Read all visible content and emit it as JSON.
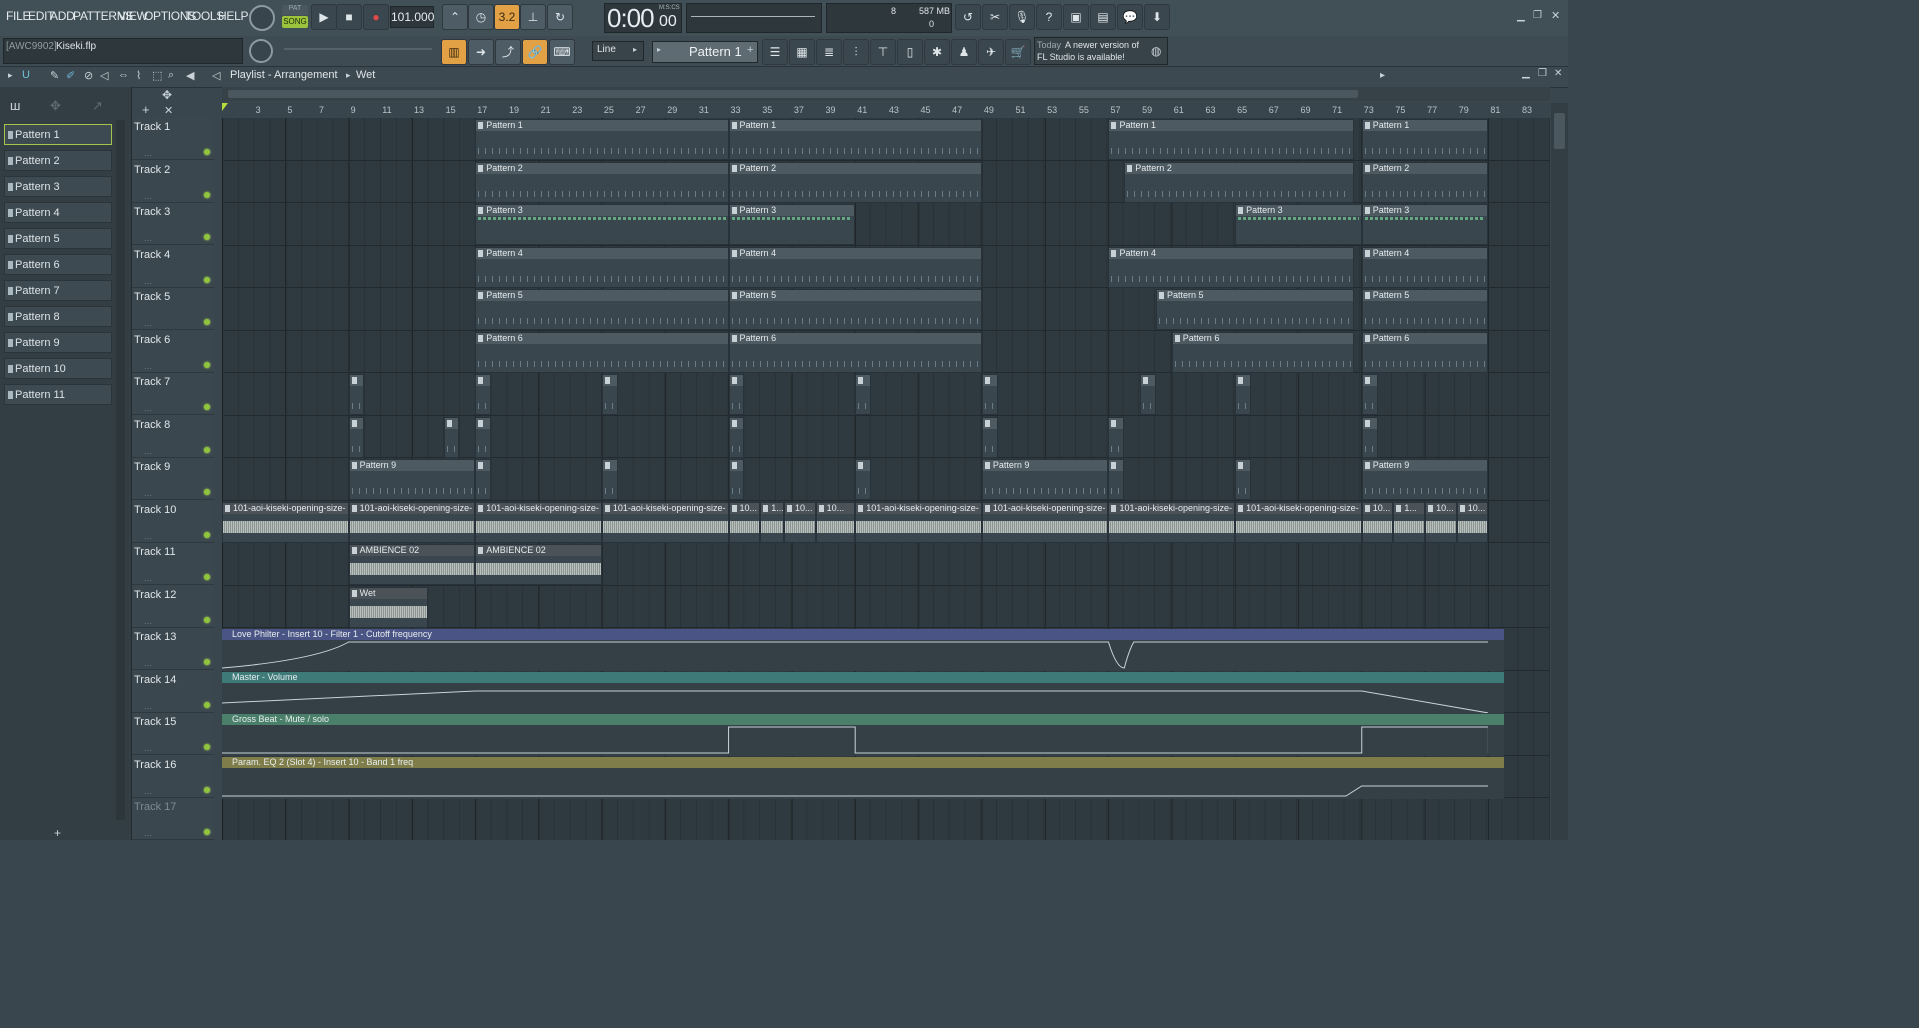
{
  "menu": [
    "FILE",
    "EDIT",
    "ADD",
    "PATTERNS",
    "VIEW",
    "OPTIONS",
    "TOOLS",
    "HELP"
  ],
  "transport": {
    "mode_pat": "PAT",
    "mode_song": "SONG",
    "tempo": "101.000",
    "time": "0:00",
    "time_cs": "00",
    "time_label": "M:S:CS"
  },
  "monitor": {
    "cpu": "8",
    "mem": "587 MB",
    "poly": "0"
  },
  "project": {
    "tag": "[AWC9902]",
    "file": "Kiseki.flp"
  },
  "snap": {
    "label": "Line"
  },
  "pattern_selector": {
    "label": "Pattern 1"
  },
  "news": {
    "date": "Today",
    "line1": "A newer version of",
    "line2": "FL Studio is available!"
  },
  "playlist": {
    "title": "Playlist - Arrangement",
    "crumb": "Wet"
  },
  "patterns": [
    "Pattern 1",
    "Pattern 2",
    "Pattern 3",
    "Pattern 4",
    "Pattern 5",
    "Pattern 6",
    "Pattern 7",
    "Pattern 8",
    "Pattern 9",
    "Pattern 10",
    "Pattern 11"
  ],
  "tracks": [
    "Track 1",
    "Track 2",
    "Track 3",
    "Track 4",
    "Track 5",
    "Track 6",
    "Track 7",
    "Track 8",
    "Track 9",
    "Track 10",
    "Track 11",
    "Track 12",
    "Track 13",
    "Track 14",
    "Track 15",
    "Track 16",
    "Track 17"
  ],
  "ruler": [
    "3",
    "5",
    "7",
    "9",
    "11",
    "13",
    "15",
    "17",
    "19",
    "21",
    "23",
    "25",
    "27",
    "29",
    "31",
    "33",
    "35",
    "37",
    "39",
    "41",
    "43",
    "45",
    "47",
    "49",
    "51",
    "53",
    "55",
    "57",
    "59",
    "61",
    "63",
    "65",
    "67",
    "69",
    "71",
    "73",
    "75",
    "77",
    "79",
    "81",
    "83"
  ],
  "clip_labels": {
    "p1": "Pattern 1",
    "p2": "Pattern 2",
    "p3": "Pattern 3",
    "p4": "Pattern 4",
    "p5": "Pattern 5",
    "p6": "Pattern 6",
    "p9": "Pattern 9",
    "audio": "101-aoi-kiseki-opening-size-",
    "audio_short": "10...",
    "audio_short2": "1...",
    "amb": "AMBIENCE 02",
    "wet": "Wet"
  },
  "automation": {
    "a13": "Love Philter - Insert 10 - Filter 1 - Cutoff frequency",
    "a14": "Master - Volume",
    "a15": "Gross Beat - Mute / solo",
    "a16": "Param. EQ 2 (Slot 4) - Insert 10 - Band 1 freq"
  },
  "colors": {
    "accent": "#e3a145",
    "led": "#8fc43c",
    "auto13": "#4b5585",
    "auto14": "#3d7a78",
    "auto15": "#4a7f6a",
    "auto16": "#7f7e4a"
  }
}
